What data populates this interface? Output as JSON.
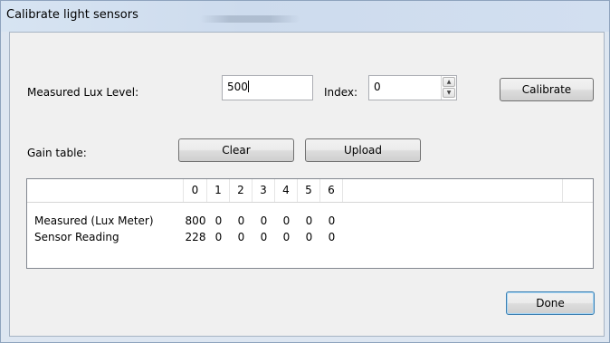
{
  "window": {
    "title": "Calibrate light sensors"
  },
  "form": {
    "lux_label": "Measured Lux Level:",
    "lux_value": "500",
    "index_label": "Index:",
    "index_value": "0",
    "calibrate_label": "Calibrate",
    "gain_label": "Gain table:",
    "clear_label": "Clear",
    "upload_label": "Upload",
    "done_label": "Done"
  },
  "spinner": {
    "up_icon": "spin-up-arrow",
    "down_icon": "spin-down-arrow"
  },
  "gain_table": {
    "columns": [
      "",
      "0",
      "1",
      "2",
      "3",
      "4",
      "5",
      "6"
    ],
    "rows": [
      {
        "label": "Measured (Lux Meter)",
        "values": [
          "800",
          "0",
          "0",
          "0",
          "0",
          "0",
          "0"
        ]
      },
      {
        "label": "Sensor Reading",
        "values": [
          "228",
          "0",
          "0",
          "0",
          "0",
          "0",
          "0"
        ]
      }
    ]
  },
  "colors": {
    "window_frame": "#dde6f1",
    "client_bg": "#f0f0f0",
    "default_button_border": "#3c7fb1"
  }
}
